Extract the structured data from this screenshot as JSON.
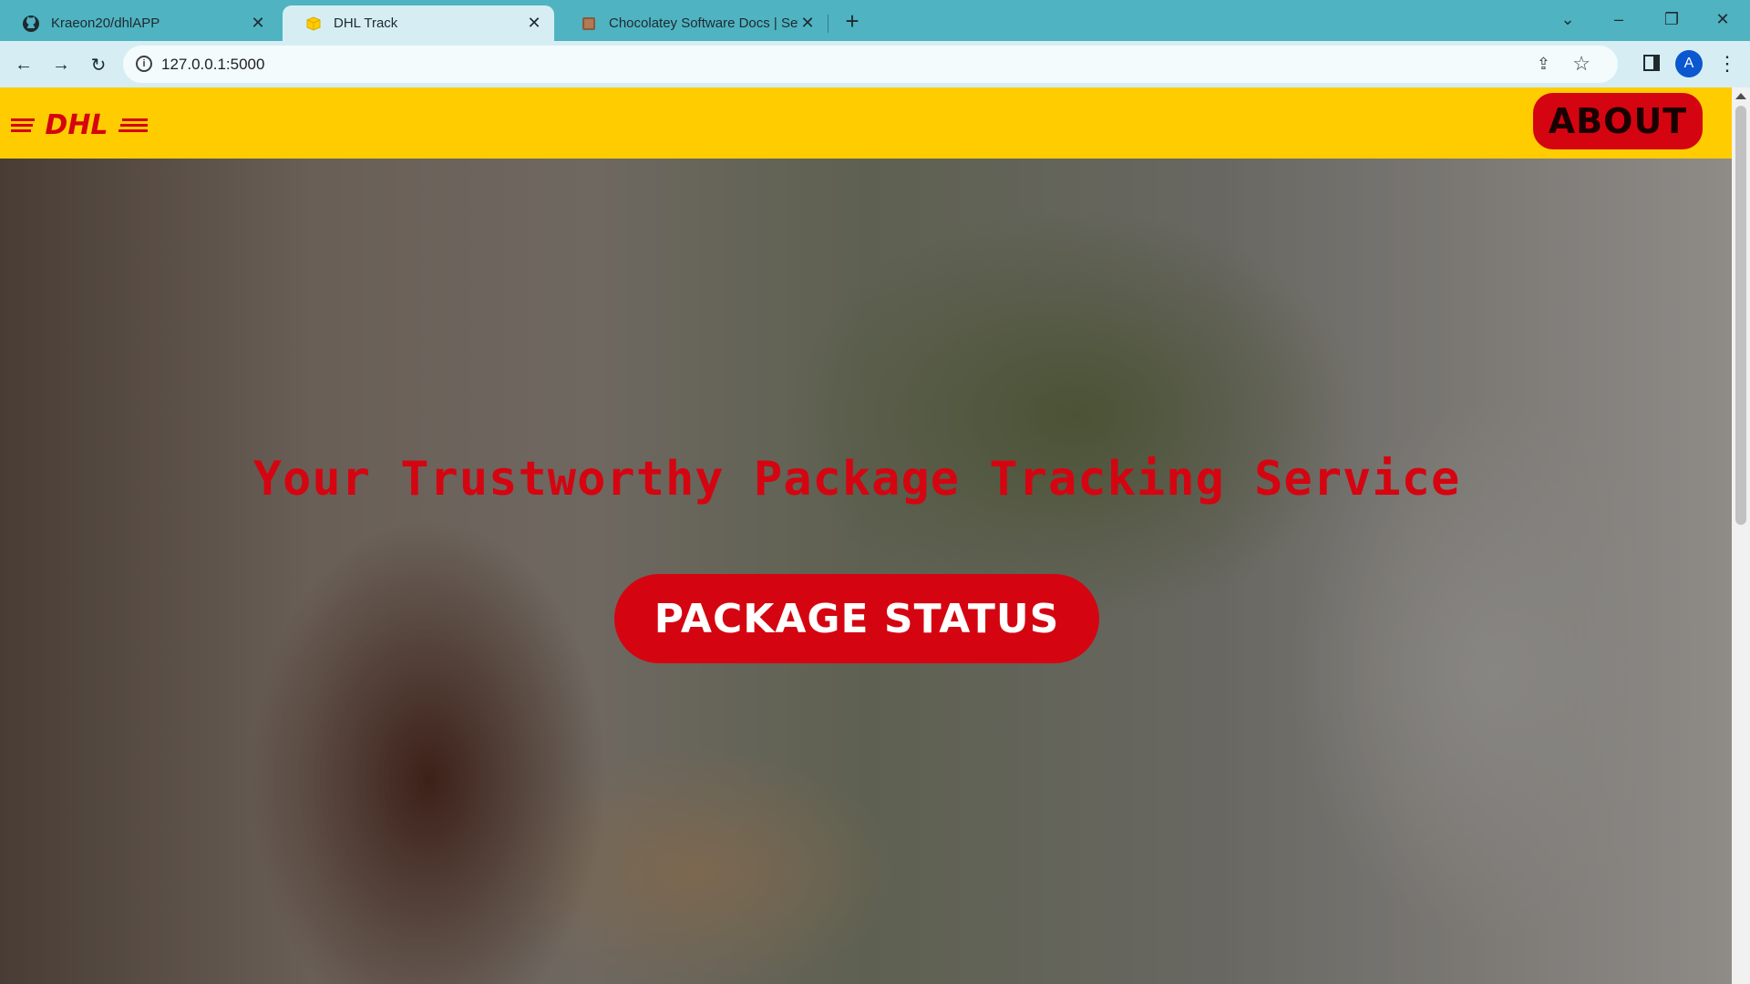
{
  "browser": {
    "tabs": [
      {
        "title": "Kraeon20/dhlAPP",
        "icon": "github-icon",
        "active": false
      },
      {
        "title": "DHL Track",
        "icon": "dhl-favicon-icon",
        "active": true
      },
      {
        "title": "Chocolatey Software Docs | Setu",
        "icon": "chocolatey-favicon-icon",
        "active": false
      }
    ],
    "url": "127.0.0.1:5000",
    "profile_initial": "A"
  },
  "site": {
    "logo_text": "DHL",
    "about_label": "ABOUT",
    "headline": "Your Trustworthy Package Tracking Service",
    "status_button_label": "PACKAGE STATUS"
  },
  "colors": {
    "brand_yellow": "#ffcc00",
    "brand_red": "#d40511"
  }
}
